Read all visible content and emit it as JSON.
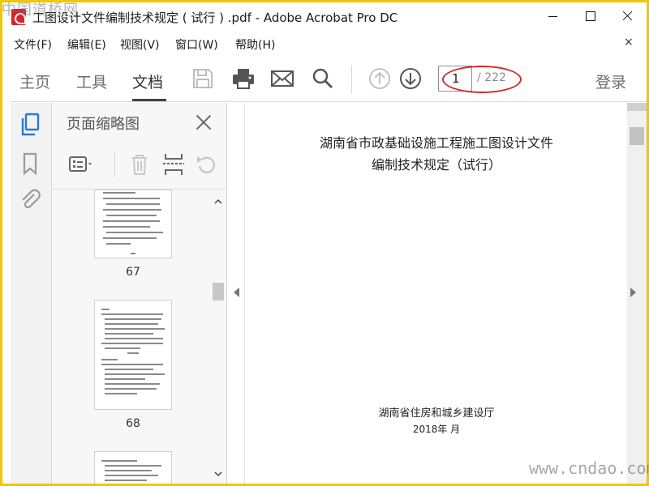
{
  "window": {
    "title": "工图设计文件编制技术规定 ( 试行 ) .pdf - Adobe Acrobat Pro DC"
  },
  "watermarks": {
    "top": "中国道桥网",
    "bottom": "www.cndao.com"
  },
  "menu": {
    "items": [
      {
        "label": "文件(F)"
      },
      {
        "label": "编辑(E)"
      },
      {
        "label": "视图(V)"
      },
      {
        "label": "窗口(W)"
      },
      {
        "label": "帮助(H)"
      }
    ],
    "close_label": "×"
  },
  "toolbar": {
    "tabs": [
      {
        "label": "主页"
      },
      {
        "label": "工具"
      },
      {
        "label": "文档",
        "active": true
      }
    ],
    "icons": [
      "save-icon",
      "print-icon",
      "email-icon",
      "search-icon",
      "page-up-icon",
      "page-down-icon"
    ],
    "page_current": "1",
    "page_total": "/ 222",
    "login_label": "登录",
    "highlight_color": "#d42a2a"
  },
  "left_rail": {
    "icons": [
      "page-thumbnails-icon",
      "bookmark-icon",
      "attachment-icon"
    ],
    "active_color": "#2b78d0"
  },
  "thumbnail_panel": {
    "title": "页面缩略图",
    "tools": [
      "options-menu-icon",
      "delete-icon",
      "extract-icon",
      "rotate-icon"
    ],
    "thumbnails": [
      {
        "page": "67"
      },
      {
        "page": "68"
      },
      {
        "page": ""
      }
    ]
  },
  "document": {
    "title_line1": "湖南省市政基础设施工程施工图设计文件",
    "title_line2": "编制技术规定（试行）",
    "organization": "湖南省住房和城乡建设厅",
    "date": "2018年  月"
  }
}
